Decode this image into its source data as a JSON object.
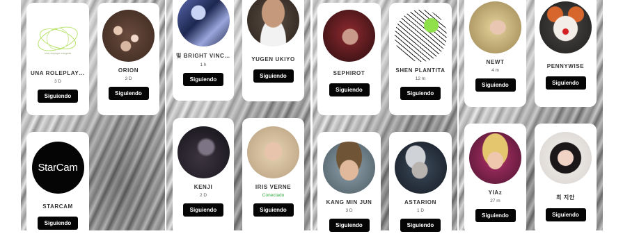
{
  "follow_label": "Siguiendo",
  "colors": {
    "button_bg": "#050505",
    "button_text": "#ffffff",
    "online_status": "#2eaa3c",
    "card_bg": "#ffffff"
  },
  "cards": [
    {
      "name": "UNA ROLEPLAYER ...",
      "status": "3 D",
      "avatar_icon": "green-ring-logo",
      "logo_caption": "Una roleplayer enlugada"
    },
    {
      "name": "ORION",
      "status": "3 D",
      "avatar_icon": "flowers-photo"
    },
    {
      "name": "STARCAM",
      "status": "",
      "avatar_icon": "starcam-logo",
      "logo_text": "StarCam"
    },
    {
      "name": "빛 BRIGHT VINCENT",
      "status": "1 h",
      "avatar_icon": "anime-character-photo"
    },
    {
      "name": "KENJI",
      "status": "2 D",
      "avatar_icon": "dark-portrait-photo"
    },
    {
      "name": "YUGEN UKIYO",
      "status": "",
      "avatar_icon": "man-portrait-photo"
    },
    {
      "name": "IRIS VERNE",
      "status": "Conectado",
      "avatar_icon": "blonde-woman-photo"
    },
    {
      "name": "SEPHIROT",
      "status": "",
      "avatar_icon": "red-hair-portrait-photo"
    },
    {
      "name": "KANG MIN JUN",
      "status": "3 D",
      "avatar_icon": "man-portrait-photo"
    },
    {
      "name": "SHEN PLANTITA",
      "status": "12 m",
      "avatar_icon": "manga-drawing-photo"
    },
    {
      "name": "ASTARION",
      "status": "1 D",
      "avatar_icon": "silver-hair-portrait-photo"
    },
    {
      "name": "NEWT",
      "status": "4 m",
      "avatar_icon": "blonde-woman-photo"
    },
    {
      "name": "YIAz",
      "status": "27 m",
      "avatar_icon": "woman-portrait-photo"
    },
    {
      "name": "PENNYWISE",
      "status": "",
      "avatar_icon": "clown-portrait-photo"
    },
    {
      "name": "최 지안",
      "status": "",
      "avatar_icon": "dark-hair-woman-photo"
    }
  ]
}
